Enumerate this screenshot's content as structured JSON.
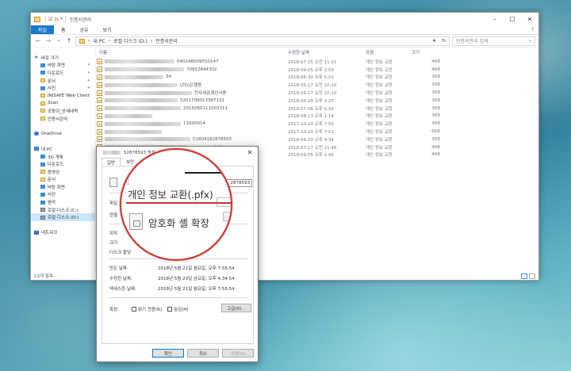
{
  "explorer": {
    "title": "인증서관리",
    "ribbon_tabs": [
      "파일",
      "홈",
      "공유",
      "보기"
    ],
    "path": [
      "내 PC",
      "로컬 디스크 (D:)",
      "인증서관리"
    ],
    "search_placeholder": "인증서관리 검색",
    "columns": {
      "name": "이름",
      "date": "수정한 날짜",
      "type": "유형",
      "size": "크기"
    },
    "nav_items": [
      {
        "label": "바로 가기",
        "icon": "star-icon"
      },
      {
        "label": "바탕 화면",
        "icon": "desktop-icon",
        "pinned": true
      },
      {
        "label": "다운로드",
        "icon": "download-icon",
        "pinned": true
      },
      {
        "label": "문서",
        "icon": "documents-icon",
        "pinned": true
      },
      {
        "label": "사진",
        "icon": "pictures-icon",
        "pinned": true
      },
      {
        "label": "INISAFE Web Client",
        "icon": "folder-icon"
      },
      {
        "label": "Scan",
        "icon": "folder-icon"
      },
      {
        "label": "공동이_상세내역",
        "icon": "folder-icon"
      },
      {
        "label": "인증서관리",
        "icon": "folder-icon"
      },
      {
        "label": "",
        "icon": ""
      },
      {
        "label": "OneDrive",
        "icon": "cloud-icon"
      },
      {
        "label": "",
        "icon": ""
      },
      {
        "label": "내 PC",
        "icon": "pc-icon"
      },
      {
        "label": "3D 개체",
        "icon": "3d-objects-icon"
      },
      {
        "label": "다운로드",
        "icon": "download-icon"
      },
      {
        "label": "동영상",
        "icon": "videos-icon"
      },
      {
        "label": "문서",
        "icon": "documents-icon"
      },
      {
        "label": "바탕 화면",
        "icon": "desktop-icon"
      },
      {
        "label": "사진",
        "icon": "pictures-icon"
      },
      {
        "label": "음악",
        "icon": "music-icon"
      },
      {
        "label": "로컬 디스크 (C:)",
        "icon": "drive-icon"
      },
      {
        "label": "로컬 디스크 (D:)",
        "icon": "drive-icon",
        "selected": true
      },
      {
        "label": "",
        "icon": ""
      },
      {
        "label": "네트워크",
        "icon": "network-icon"
      }
    ],
    "files": [
      {
        "name_visible": "040248009550147",
        "date": "2018-07-25 오전 11:21",
        "type": "개인 정보 교환",
        "size": "4KB"
      },
      {
        "name_visible": "70912844302",
        "date": "2018-09-05 오후 2:59",
        "type": "개인 정보 교환",
        "size": "4KB"
      },
      {
        "name_visible": "34",
        "date": "2018-06-30 오후 5:21",
        "type": "개인 정보 교환",
        "size": "3KB"
      },
      {
        "name_visible": "LTD)은행용",
        "date": "2018-05-17 오전 10:10",
        "type": "개인 정보 교환",
        "size": "3KB"
      },
      {
        "name_visible": "전자세금계산서용",
        "date": "2018-05-17 오전 10:10",
        "type": "개인 정보 교환",
        "size": "3KB"
      },
      {
        "name_visible": "5201706013387131",
        "date": "2018-06-20 오후 2:25",
        "type": "개인 정보 교환",
        "size": "3KB"
      },
      {
        "name_visible": "2015060111003311",
        "date": "2018-07-06 오후 5:42",
        "type": "개인 정보 교환",
        "size": "3KB"
      },
      {
        "name_visible": "",
        "date": "2018-08-13 오후 1:14",
        "type": "개인 정보 교환",
        "size": "3KB"
      },
      {
        "name_visible": "11000914",
        "date": "2017-10-24 오후 7:50",
        "type": "개인 정보 교환",
        "size": "3KB"
      },
      {
        "name_visible": "",
        "date": "2017-10-24 오후 7:51",
        "type": "개인 정보 교환",
        "size": "6KB"
      },
      {
        "name_visible": "01804182878593",
        "date": "2018-04-20 오후 4:34",
        "type": "개인 정보 교환",
        "size": "3KB"
      },
      {
        "name_visible": "52878593 속성",
        "date": "2018-07-17 오전 11:46",
        "type": "개인 정보 교환",
        "size": "4KB"
      },
      {
        "name_visible": "",
        "date": "2018-09-05 오후 1:43",
        "type": "개인 정보 교환",
        "size": "4KB"
      }
    ],
    "status": "13개 항목"
  },
  "dialog": {
    "title": "52878593 속성",
    "tabs": [
      "일반",
      "보안"
    ],
    "filename_tail": "2878593",
    "labels": {
      "filetype": "파일",
      "openwith": "연결",
      "location": "위치",
      "size": "크기",
      "disksize": "디스크 할당",
      "created": "만든 날짜:",
      "modified": "수정한 날짜:",
      "accessed": "액세스한 날짜:",
      "attributes": "특성:"
    },
    "created_val": "2018년 5월 21일 월요일, 오후 7:55:54",
    "modified_val": "2018년 5월 20일 금요일, 오후 4:34:54",
    "accessed_val": "2018년 5월 21일 월요일, 오후 7:55:54",
    "readonly_label": "읽기 전용(R)",
    "hidden_label": "숨김(H)",
    "advanced_label": "고급(D)...",
    "ok_label": "확인",
    "cancel_label": "취소",
    "apply_label": "적용(A)"
  },
  "magnifier": {
    "filetype_text": "개인 정보 교환(.pfx)",
    "ext_text": "암호화 셸 확장",
    "accent_color": "#c8352c"
  }
}
